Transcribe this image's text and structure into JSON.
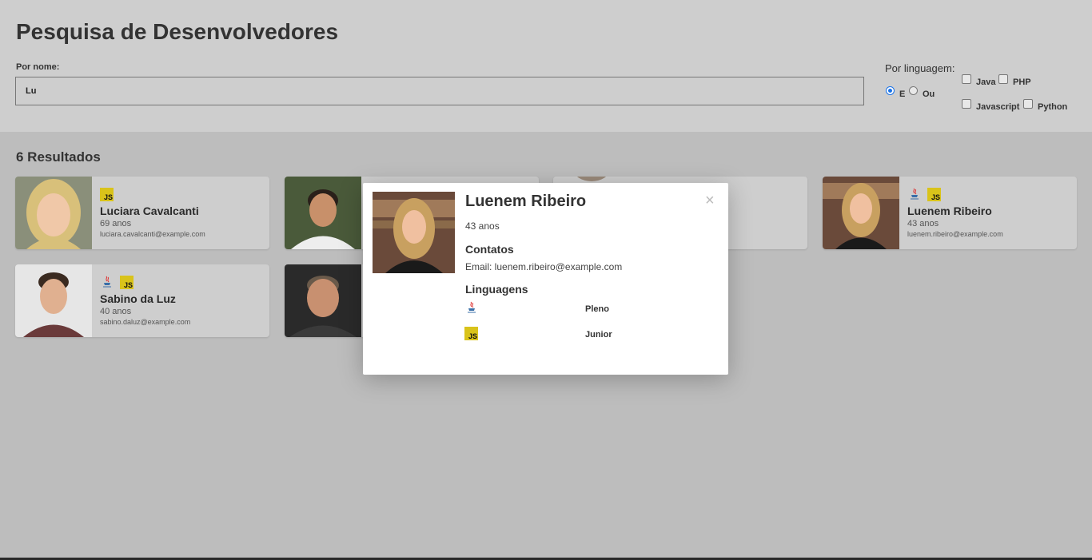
{
  "header": {
    "title": "Pesquisa de Desenvolvedores",
    "name_label": "Por nome:",
    "name_value": "Lu",
    "language_label": "Por linguagem:",
    "mode_options": [
      {
        "label": "E",
        "checked": true
      },
      {
        "label": "Ou",
        "checked": false
      }
    ],
    "language_options": [
      {
        "label": "Java",
        "checked": false
      },
      {
        "label": "PHP",
        "checked": false
      },
      {
        "label": "Javascript",
        "checked": false
      },
      {
        "label": "Python",
        "checked": false
      }
    ]
  },
  "results_label": "6 Resultados",
  "cards": [
    {
      "name": "Luciara Cavalcanti",
      "age": "69 anos",
      "email": "luciara.cavalcanti@example.com",
      "languages": [
        "javascript"
      ]
    },
    {
      "name": "",
      "age": "",
      "email": "",
      "languages": []
    },
    {
      "name": "",
      "age": "",
      "email": "",
      "languages": []
    },
    {
      "name": "Luenem Ribeiro",
      "age": "43 anos",
      "email": "luenem.ribeiro@example.com",
      "languages": [
        "java",
        "javascript"
      ]
    },
    {
      "name": "Sabino da Luz",
      "age": "40 anos",
      "email": "sabino.daluz@example.com",
      "languages": [
        "java",
        "javascript"
      ]
    },
    {
      "name": "",
      "age": "",
      "email": "",
      "languages": []
    }
  ],
  "modal": {
    "name": "Luenem Ribeiro",
    "close_icon": "×",
    "age": "43 anos",
    "contacts_title": "Contatos",
    "email": "Email: luenem.ribeiro@example.com",
    "languages_title": "Linguagens",
    "languages": [
      {
        "icon": "java-icon",
        "level": "Pleno"
      },
      {
        "icon": "javascript-icon",
        "level": "Junior"
      }
    ]
  },
  "icons": {
    "js_text": "JS"
  },
  "colors": {
    "accent": "#1a73e8",
    "js_badge": "#d9c31a"
  }
}
